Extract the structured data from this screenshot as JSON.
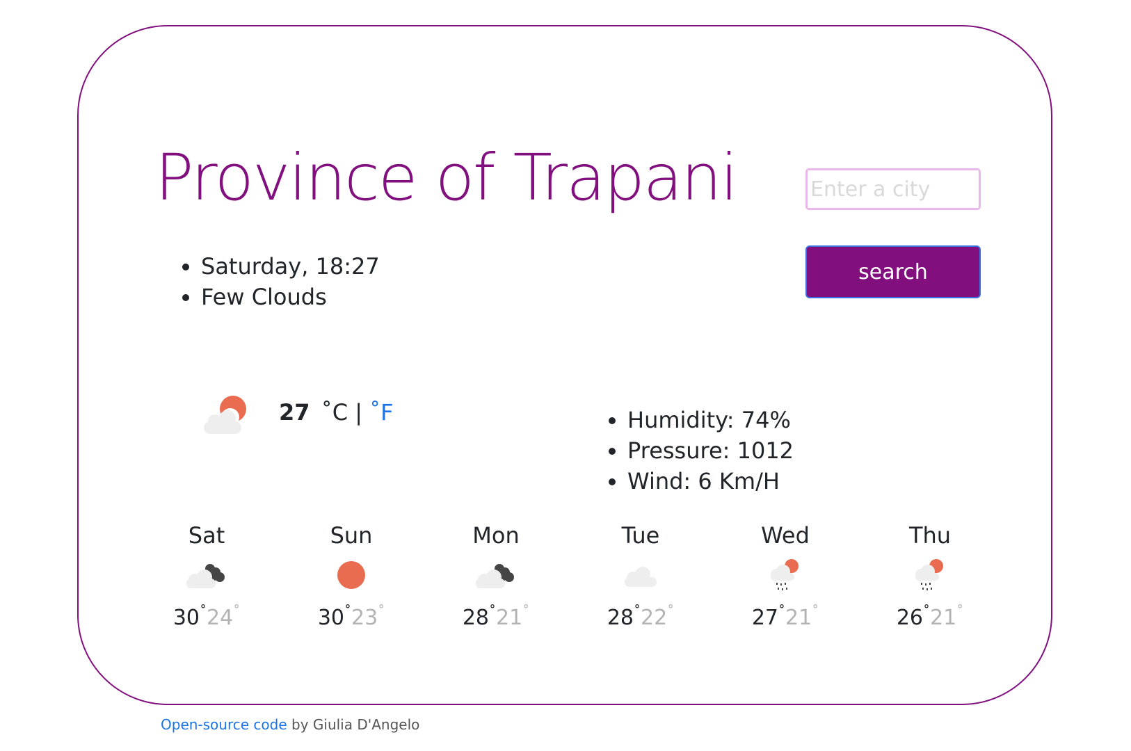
{
  "city": "Province of Trapani",
  "search": {
    "placeholder": "Enter a city",
    "button_label": "search"
  },
  "info": [
    "Saturday, 18:27",
    "Few Clouds"
  ],
  "current": {
    "icon": "few-clouds-icon",
    "temperature": "27",
    "unit_c": "˚C",
    "separator": "|",
    "unit_f": "˚F"
  },
  "details": [
    "Humidity: 74%",
    "Pressure: 1012",
    "Wind: 6 Km/H"
  ],
  "forecast": [
    {
      "day": "Sat",
      "icon": "broken-clouds-icon",
      "max": "30",
      "min": "24"
    },
    {
      "day": "Sun",
      "icon": "clear-sky-icon",
      "max": "30",
      "min": "23"
    },
    {
      "day": "Mon",
      "icon": "broken-clouds-icon",
      "max": "28",
      "min": "21"
    },
    {
      "day": "Tue",
      "icon": "cloud-icon",
      "max": "28",
      "min": "22"
    },
    {
      "day": "Wed",
      "icon": "rain-sun-icon",
      "max": "27",
      "min": "21"
    },
    {
      "day": "Thu",
      "icon": "rain-sun-icon",
      "max": "26",
      "min": "21"
    }
  ],
  "degree_symbol": "˚",
  "footer": {
    "link_text": "Open-source code",
    "credit": " by Giulia D'Angelo"
  },
  "colors": {
    "accent": "#820f7e",
    "link": "#1a73e8",
    "sun": "#e96b50",
    "dark_cloud": "#454545",
    "light_cloud": "#eeeeee"
  }
}
